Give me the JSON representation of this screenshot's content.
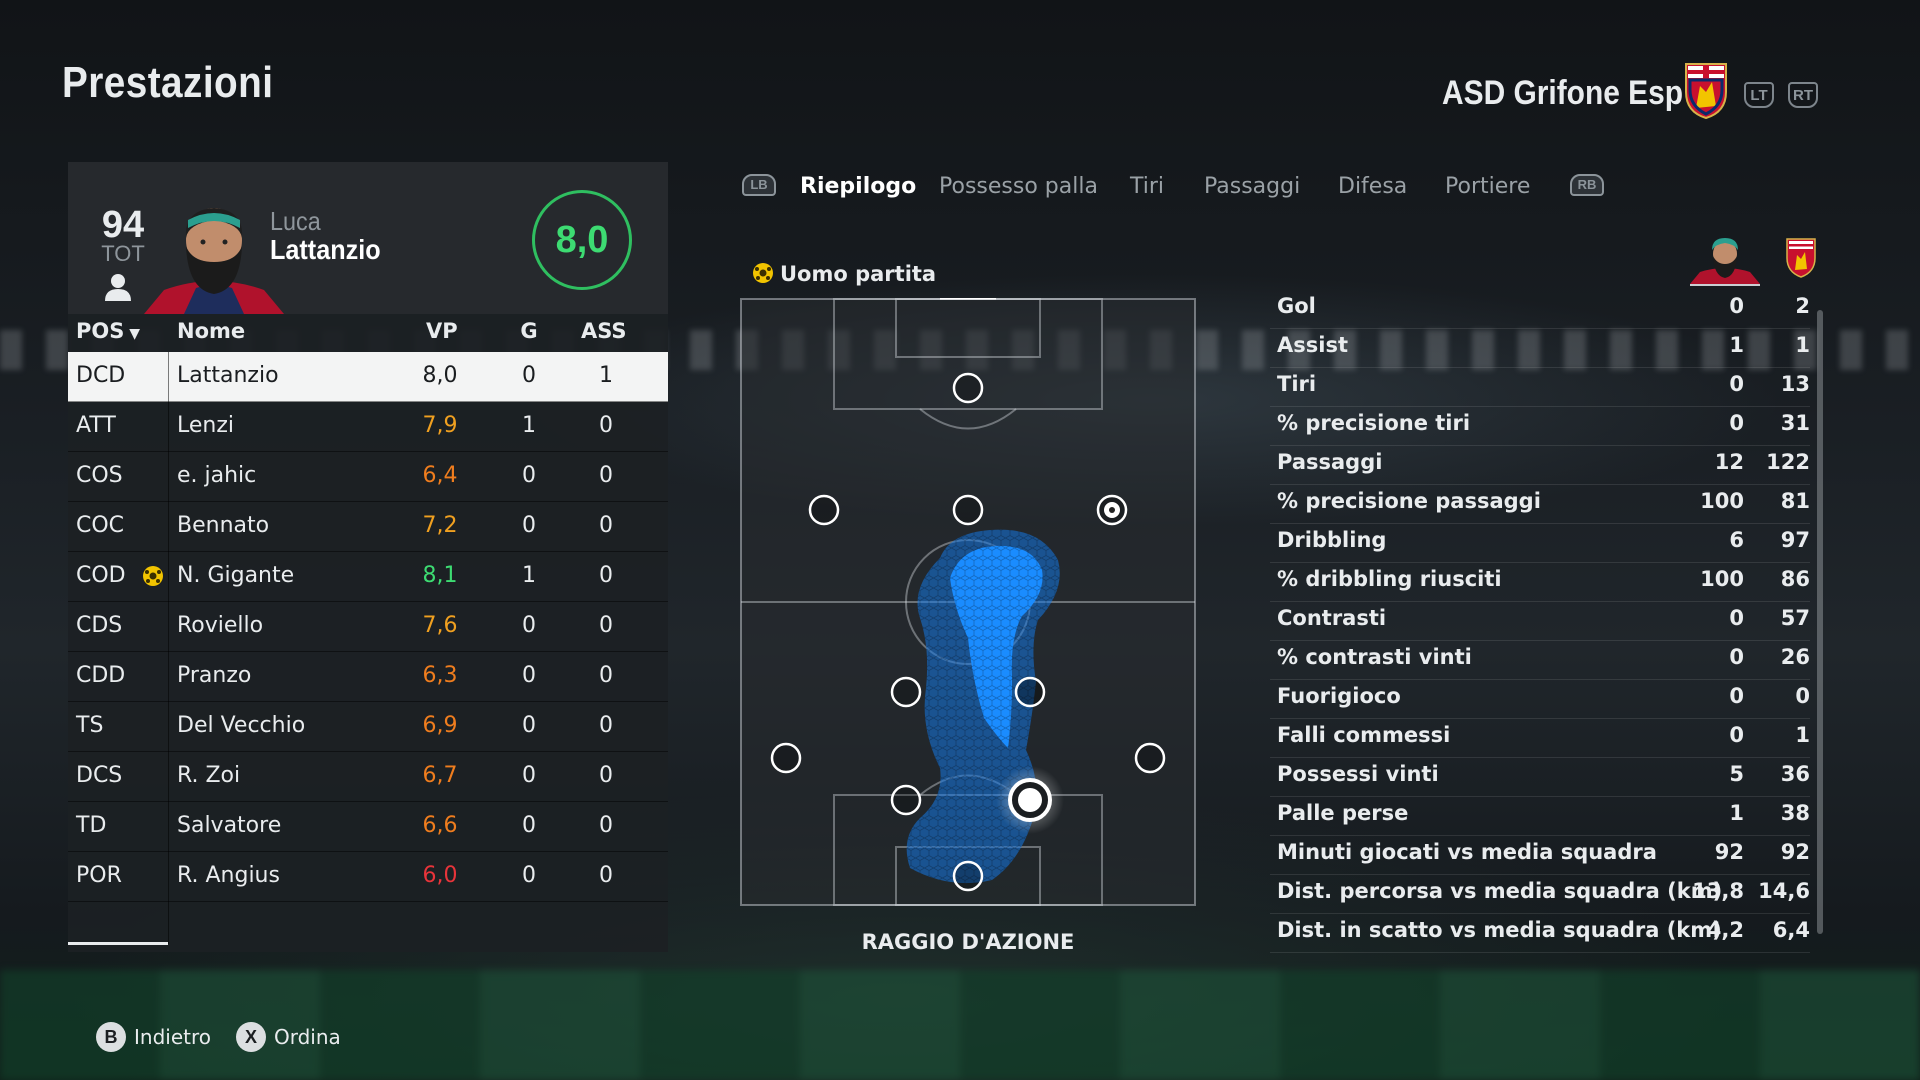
{
  "header": {
    "title": "Prestazioni",
    "team_name": "ASD Grifone Esp",
    "lt_label": "LT",
    "rt_label": "RT"
  },
  "player": {
    "overall": "94",
    "overall_label": "TOT",
    "first_name": "Luca",
    "last_name": "Lattanzio",
    "rating": "8,0"
  },
  "table": {
    "headers": {
      "pos": "POS",
      "name": "Nome",
      "vp": "VP",
      "g": "G",
      "ass": "ASS"
    },
    "rows": [
      {
        "pos": "DCD",
        "name": "Lattanzio",
        "vp": "8,0",
        "g": "0",
        "ass": "1",
        "color": "#1a1d20",
        "motm": false
      },
      {
        "pos": "ATT",
        "name": "Lenzi",
        "vp": "7,9",
        "g": "1",
        "ass": "0",
        "color": "#f0a020",
        "motm": false
      },
      {
        "pos": "COS",
        "name": "e. jahic",
        "vp": "6,4",
        "g": "0",
        "ass": "0",
        "color": "#ef7d1e",
        "motm": false
      },
      {
        "pos": "COC",
        "name": "Bennato",
        "vp": "7,2",
        "g": "0",
        "ass": "0",
        "color": "#f0a020",
        "motm": false
      },
      {
        "pos": "COD",
        "name": "N. Gigante",
        "vp": "8,1",
        "g": "1",
        "ass": "0",
        "color": "#3ddb72",
        "motm": true
      },
      {
        "pos": "CDS",
        "name": "Roviello",
        "vp": "7,6",
        "g": "0",
        "ass": "0",
        "color": "#f0a020",
        "motm": false
      },
      {
        "pos": "CDD",
        "name": "Pranzo",
        "vp": "6,3",
        "g": "0",
        "ass": "0",
        "color": "#ef7d1e",
        "motm": false
      },
      {
        "pos": "TS",
        "name": "Del Vecchio",
        "vp": "6,9",
        "g": "0",
        "ass": "0",
        "color": "#ef7d1e",
        "motm": false
      },
      {
        "pos": "DCS",
        "name": "R. Zoi",
        "vp": "6,7",
        "g": "0",
        "ass": "0",
        "color": "#ef7d1e",
        "motm": false
      },
      {
        "pos": "TD",
        "name": "Salvatore",
        "vp": "6,6",
        "g": "0",
        "ass": "0",
        "color": "#ef7d1e",
        "motm": false
      },
      {
        "pos": "POR",
        "name": "R. Angius",
        "vp": "6,0",
        "g": "0",
        "ass": "0",
        "color": "#e8343a",
        "motm": false
      }
    ]
  },
  "tabs": {
    "lb": "LB",
    "rb": "RB",
    "items": [
      "Riepilogo",
      "Possesso palla",
      "Tiri",
      "Passaggi",
      "Difesa",
      "Portiere"
    ],
    "active": 0
  },
  "motm_label": "Uomo partita",
  "action_label": "RAGGIO D'AZIONE",
  "stats": [
    {
      "label": "Gol",
      "player": "0",
      "team": "2"
    },
    {
      "label": "Assist",
      "player": "1",
      "team": "1"
    },
    {
      "label": "Tiri",
      "player": "0",
      "team": "13"
    },
    {
      "label": "% precisione tiri",
      "player": "0",
      "team": "31"
    },
    {
      "label": "Passaggi",
      "player": "12",
      "team": "122"
    },
    {
      "label": "% precisione passaggi",
      "player": "100",
      "team": "81"
    },
    {
      "label": "Dribbling",
      "player": "6",
      "team": "97"
    },
    {
      "label": "% dribbling riusciti",
      "player": "100",
      "team": "86"
    },
    {
      "label": "Contrasti",
      "player": "0",
      "team": "57"
    },
    {
      "label": "% contrasti vinti",
      "player": "0",
      "team": "26"
    },
    {
      "label": "Fuorigioco",
      "player": "0",
      "team": "0"
    },
    {
      "label": "Falli commessi",
      "player": "0",
      "team": "1"
    },
    {
      "label": "Possessi vinti",
      "player": "5",
      "team": "36"
    },
    {
      "label": "Palle perse",
      "player": "1",
      "team": "38"
    },
    {
      "label": "Minuti giocati vs media squadra",
      "player": "92",
      "team": "92"
    },
    {
      "label": "Dist. percorsa vs media squadra (km)",
      "player": "13,8",
      "team": "14,6"
    },
    {
      "label": "Dist. in scatto vs media squadra (km)",
      "player": "4,2",
      "team": "6,4"
    }
  ],
  "footer": {
    "back_button": "B",
    "back_label": "Indietro",
    "sort_button": "X",
    "sort_label": "Ordina"
  },
  "colors": {
    "rating_green": "#3ddb72",
    "heatmap_blue": "#1a8cff",
    "motm_yellow": "#f2c400"
  }
}
